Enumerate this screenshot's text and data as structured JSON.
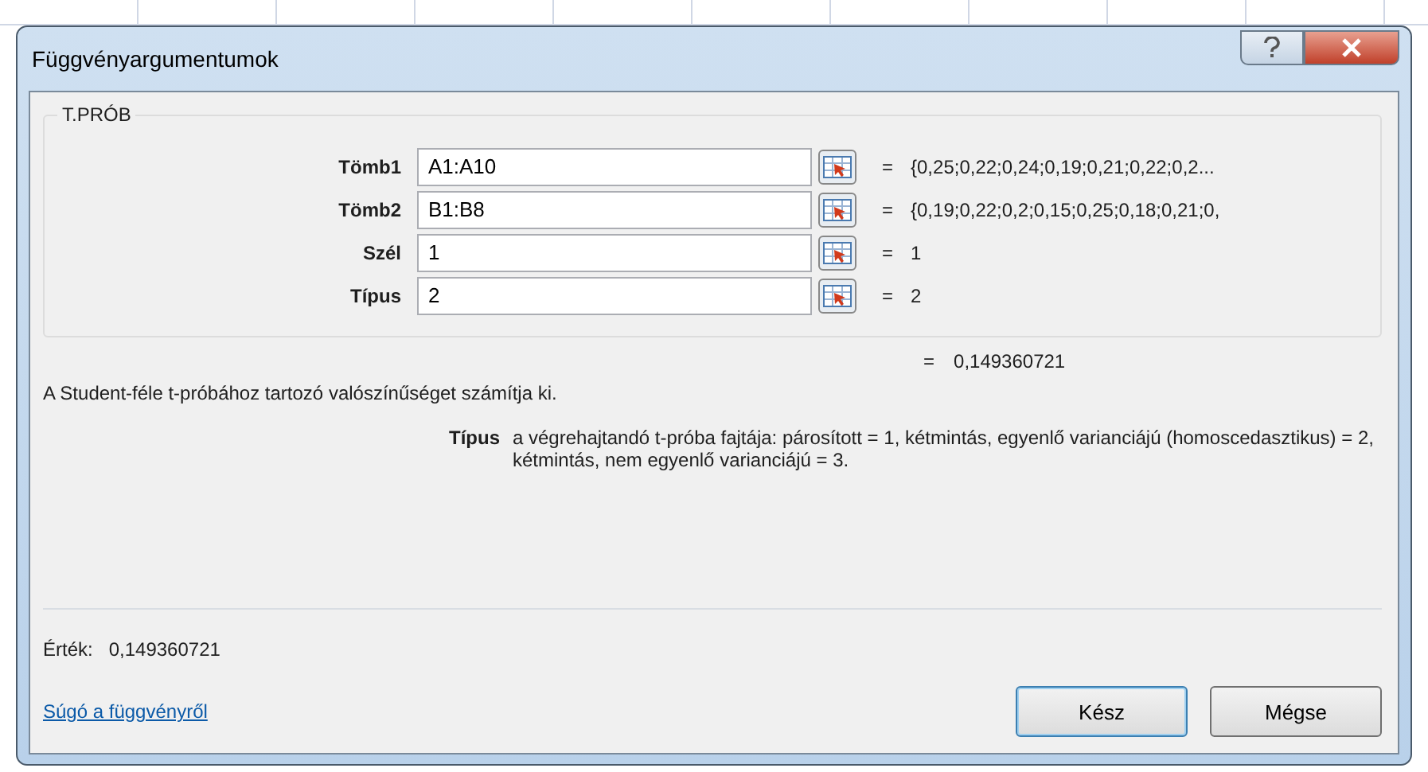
{
  "window": {
    "title": "Függvényargumentumok"
  },
  "group": {
    "title": "T.PRÓB",
    "args": [
      {
        "label": "Tömb1",
        "value": "A1:A10",
        "result": "{0,25;0,22;0,24;0,19;0,21;0,22;0,2..."
      },
      {
        "label": "Tömb2",
        "value": "B1:B8",
        "result": "{0,19;0,22;0,2;0,15;0,25;0,18;0,21;0,"
      },
      {
        "label": "Szél",
        "value": "1",
        "result": "1"
      },
      {
        "label": "Típus",
        "value": "2",
        "result": "2"
      }
    ]
  },
  "equals": "=",
  "formula_result": "0,149360721",
  "description": "A Student-féle t-próbához tartozó valószínűséget számítja ki.",
  "arg_help": {
    "label": "Típus",
    "text": "a végrehajtandó t-próba fajtája: párosított = 1, kétmintás, egyenlő varianciájú (homoscedasztikus) = 2, kétmintás, nem egyenlő varianciájú = 3."
  },
  "value_label": "Érték:",
  "value": "0,149360721",
  "help_link": "Súgó a függvényről",
  "buttons": [
    {
      "label": "Kész",
      "selected": true
    },
    {
      "label": "Mégse",
      "selected": false
    }
  ]
}
